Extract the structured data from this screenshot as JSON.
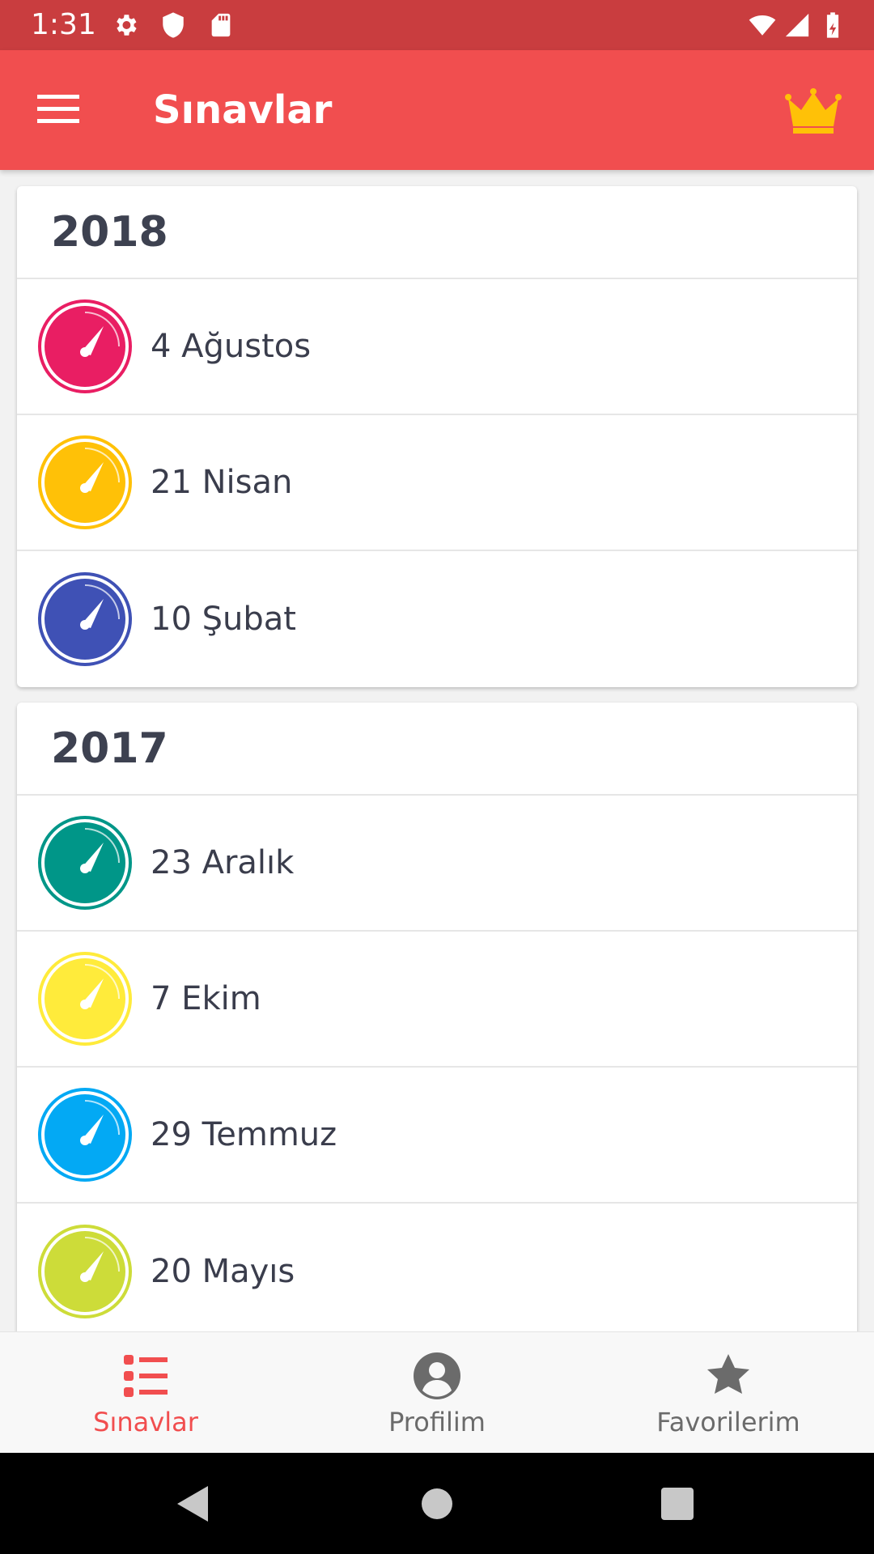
{
  "status_bar": {
    "time": "1:31",
    "icons": [
      "gear-icon",
      "shield-icon",
      "sd-card-icon",
      "wifi-icon",
      "signal-icon",
      "battery-icon"
    ]
  },
  "app_bar": {
    "title": "Sınavlar",
    "menu_icon": "menu-icon",
    "action_icon": "crown-icon",
    "background": "#f14e4f"
  },
  "sections": [
    {
      "year": "2018",
      "exams": [
        {
          "label": "4 Ağustos",
          "color": "#e91e63"
        },
        {
          "label": "21 Nisan",
          "color": "#ffc107"
        },
        {
          "label": "10 Şubat",
          "color": "#3f51b5"
        }
      ]
    },
    {
      "year": "2017",
      "exams": [
        {
          "label": "23 Aralık",
          "color": "#009688"
        },
        {
          "label": "7 Ekim",
          "color": "#ffeb3b"
        },
        {
          "label": "29 Temmuz",
          "color": "#03a9f4"
        },
        {
          "label": "20 Mayıs",
          "color": "#cddc39"
        }
      ]
    }
  ],
  "bottom_nav": {
    "items": [
      {
        "label": "Sınavlar",
        "icon": "list-icon",
        "active": true
      },
      {
        "label": "Profilim",
        "icon": "profile-icon",
        "active": false
      },
      {
        "label": "Favorilerim",
        "icon": "star-icon",
        "active": false
      }
    ],
    "active_color": "#f14e4f"
  },
  "system_nav": [
    "back-button",
    "home-button",
    "recents-button"
  ]
}
